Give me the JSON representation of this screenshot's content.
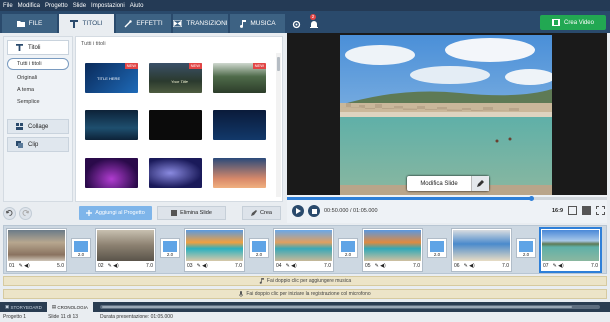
{
  "menu": [
    "File",
    "Modifica",
    "Progetto",
    "Slide",
    "Impostazioni",
    "Aiuto"
  ],
  "tabs": [
    {
      "label": "FILE",
      "icon": "folder-icon",
      "active": false
    },
    {
      "label": "TITOLI",
      "icon": "text-t-icon",
      "active": true
    },
    {
      "label": "EFFETTI",
      "icon": "magic-wand-icon",
      "active": false
    },
    {
      "label": "TRANSIZIONI",
      "icon": "transition-icon",
      "active": false
    },
    {
      "label": "MUSICA",
      "icon": "music-note-icon",
      "active": false
    }
  ],
  "toolbar": {
    "notification_count": "2",
    "create_video_label": "Crea Video"
  },
  "sidebar": {
    "titles_label": "Titoli",
    "items": [
      "Tutti i titoli",
      "Originali",
      "A tema",
      "Semplice"
    ],
    "collage_label": "Collage",
    "clip_label": "Clip"
  },
  "gallery": {
    "title": "Tutti i titoli",
    "new_tag": "NEW",
    "thumbs": [
      {
        "new": true,
        "text": "TITLE HERE"
      },
      {
        "new": true,
        "text": "Your Title"
      },
      {
        "new": true,
        "text": ""
      },
      {
        "new": false,
        "text": ""
      },
      {
        "new": false,
        "text": ""
      },
      {
        "new": false,
        "text": ""
      },
      {
        "new": false,
        "text": ""
      },
      {
        "new": false,
        "text": ""
      },
      {
        "new": false,
        "text": ""
      }
    ]
  },
  "actions": {
    "add_label": "Aggiungi al Progetto",
    "delete_label": "Elimina Slide",
    "create_label": "Crea"
  },
  "preview": {
    "modify_label": "Modifica Slide"
  },
  "player": {
    "time": "00:50.000 / 01:05.000",
    "progress": 0.77,
    "aspect": "16:9"
  },
  "timeline": {
    "clips": [
      {
        "num": "01",
        "dur": "5.0",
        "selected": false
      },
      {
        "num": "02",
        "dur": "7.0",
        "selected": false
      },
      {
        "num": "03",
        "dur": "7.0",
        "selected": false
      },
      {
        "num": "04",
        "dur": "7.0",
        "selected": false
      },
      {
        "num": "05",
        "dur": "7.0",
        "selected": false
      },
      {
        "num": "06",
        "dur": "7.0",
        "selected": false
      },
      {
        "num": "07",
        "dur": "7.0",
        "selected": true
      }
    ],
    "transitions": [
      "2.0",
      "2.0",
      "2.0",
      "2.0",
      "2.0",
      "2.0"
    ],
    "music_hint": "Fai doppio clic per aggiungere musica",
    "voice_hint": "Fai doppio clic per iniziare la registrazione col microfono"
  },
  "modes": {
    "storyboard": "STORYBOARD",
    "timeline": "CRONOLOGIA"
  },
  "status": {
    "project": "Progetto 1",
    "slide": "Slide 11 di 13",
    "duration": "Durata presentazione: 01:05.000"
  },
  "colors": {
    "accent": "#2e7fd8",
    "header": "#2a4a6c",
    "create": "#22a852"
  }
}
